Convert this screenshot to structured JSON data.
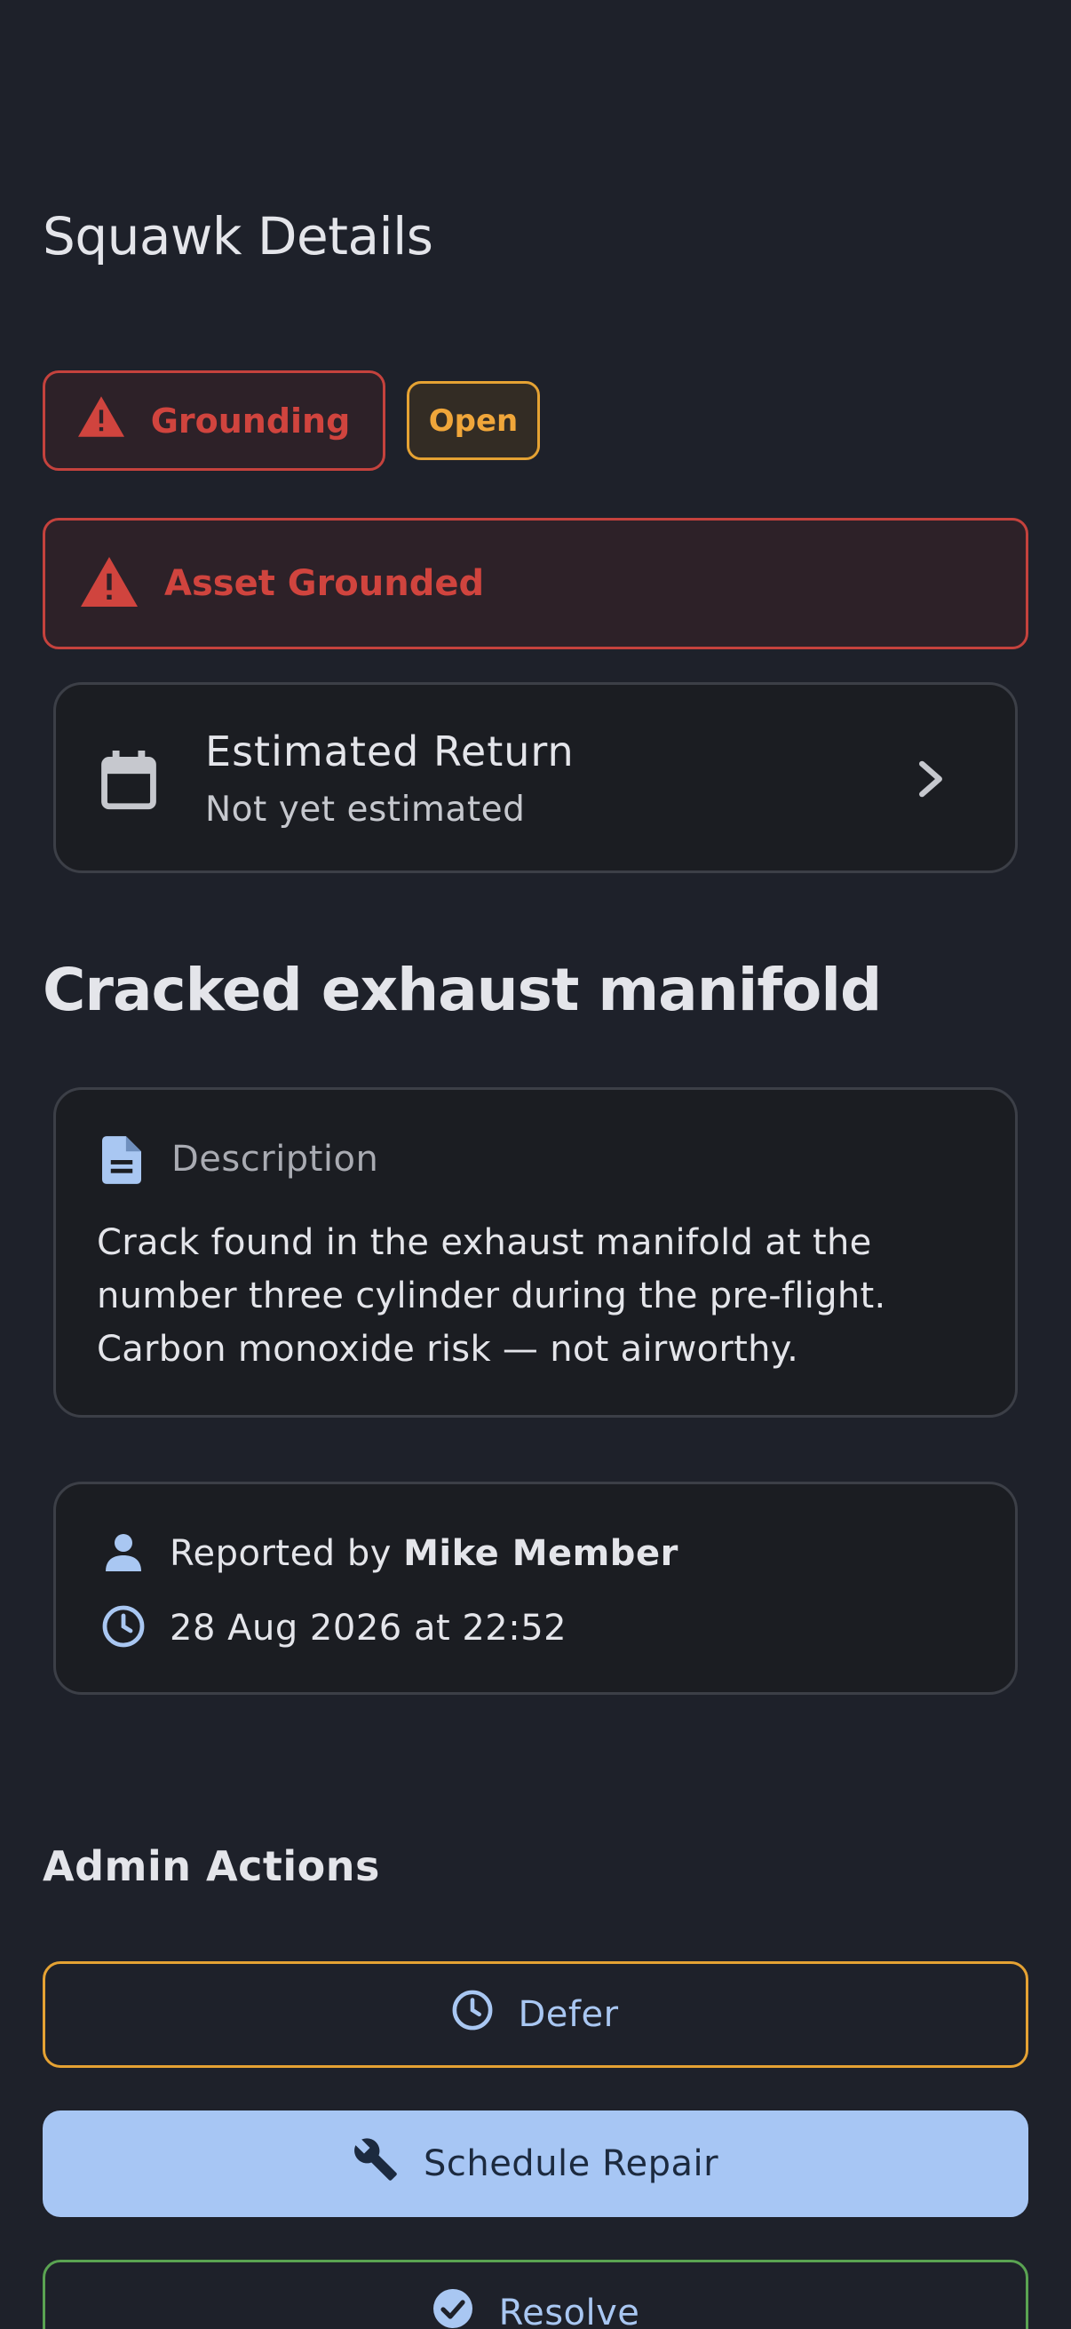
{
  "header": {
    "title": "Squawk Details"
  },
  "chips": {
    "severity": "Grounding",
    "status": "Open"
  },
  "banner": {
    "label": "Asset Grounded"
  },
  "estimated_return": {
    "title": "Estimated Return",
    "value": "Not yet estimated"
  },
  "squawk": {
    "title": "Cracked exhaust manifold",
    "description_label": "Description",
    "description": "Crack found in the exhaust manifold at the number three cylinder during the pre-flight. Carbon monoxide risk — not airworthy."
  },
  "meta": {
    "reported_prefix": "Reported by",
    "reporter": "Mike Member",
    "timestamp": "28 Aug 2026 at 22:52"
  },
  "admin": {
    "title": "Admin Actions",
    "defer_label": "Defer",
    "repair_label": "Schedule Repair",
    "resolve_label": "Resolve"
  },
  "icons": {
    "warning": "warning-triangle-icon",
    "calendar": "calendar-icon",
    "chevron": "chevron-right-icon",
    "document": "document-icon",
    "person": "person-icon",
    "clock": "clock-icon",
    "wrench": "wrench-icon",
    "check": "check-circle-icon"
  },
  "colors": {
    "background": "#1e212a",
    "danger": "#d0443e",
    "warning": "#e5a233",
    "success": "#5aa352",
    "primary": "#a7c6f4"
  }
}
